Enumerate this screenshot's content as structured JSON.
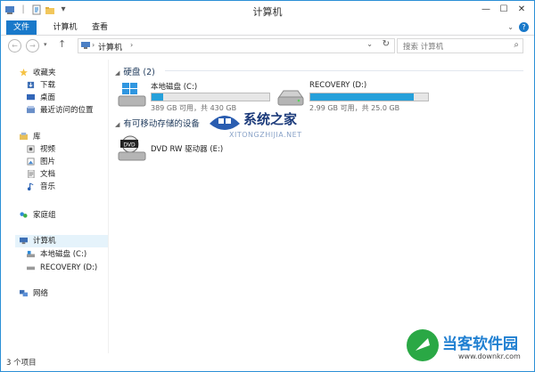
{
  "window": {
    "title": "计算机"
  },
  "ribbon": {
    "tabs": [
      "文件",
      "计算机",
      "查看"
    ]
  },
  "address": {
    "crumb": "计算机",
    "search_placeholder": "搜索 计算机"
  },
  "nav": {
    "favorites": "收藏夹",
    "downloads": "下载",
    "desktop": "桌面",
    "recent": "最近访问的位置",
    "libraries": "库",
    "videos": "视频",
    "pictures": "图片",
    "documents": "文档",
    "music": "音乐",
    "homegroup": "家庭组",
    "computer": "计算机",
    "drive_c": "本地磁盘 (C:)",
    "drive_d": "RECOVERY (D:)",
    "network": "网络"
  },
  "content": {
    "hdd_group": "硬盘 (2)",
    "removable_group": "有可移动存储的设备",
    "drives": [
      {
        "name": "本地磁盘 (C:)",
        "free": "389 GB 可用，共 430 GB",
        "used_fraction": 0.1
      },
      {
        "name": "RECOVERY (D:)",
        "free": "2.99 GB 可用，共 25.0 GB",
        "used_fraction": 0.88
      }
    ],
    "dvd": {
      "name": "DVD RW 驱动器 (E:)",
      "icon_label": "DVD"
    }
  },
  "watermark": {
    "text": "系统之家",
    "sub": "XITONGZHIJIA.NET"
  },
  "logo": {
    "text": "当客软件园",
    "url": "www.downkr.com"
  },
  "status": {
    "count": "3 个项目"
  },
  "colors": {
    "accent": "#1979ca",
    "bar": "#26a0da"
  }
}
